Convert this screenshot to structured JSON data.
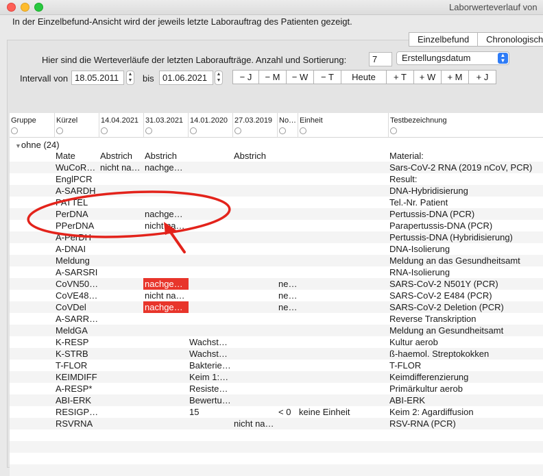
{
  "window": {
    "title": "Laborwerteverlauf von"
  },
  "info_text": "In der Einzelbefund-Ansicht wird der jeweils letzte Laborauftrag des Patienten gezeigt.",
  "view_tabs": [
    "Einzelbefund",
    "Chronologisch"
  ],
  "controls": {
    "intro_label": "Hier sind die Werteverläufe der letzten Laboraufträge. Anzahl und Sortierung:",
    "count_value": "7",
    "sort_value": "Erstellungsdatum",
    "interval_label": "Intervall von",
    "date_from": "18.05.2011",
    "bis_label": "bis",
    "date_to": "01.06.2021",
    "range_buttons": [
      "− J",
      "− M",
      "− W",
      "− T",
      "Heute",
      "+ T",
      "+ W",
      "+ M",
      "+ J"
    ]
  },
  "table": {
    "columns": [
      "Gruppe",
      "Kürzel",
      "14.04.2021",
      "31.03.2021",
      "14.01.2020",
      "27.03.2019",
      "No…",
      "Einheit",
      "Testbezeichnung"
    ],
    "group_label": "ohne (24)",
    "rows": [
      [
        "",
        "Mate",
        "Abstrich",
        "Abstrich",
        "",
        "Abstrich",
        "",
        "",
        "Material:"
      ],
      [
        "",
        "WuCoR…",
        "nicht na…",
        "nachge…",
        "",
        "",
        "",
        "",
        "Sars-CoV-2 RNA (2019 nCoV, PCR)"
      ],
      [
        "",
        "EnglPCR",
        "",
        "",
        "",
        "",
        "",
        "",
        "Result:"
      ],
      [
        "",
        "A-SARDH",
        "",
        "",
        "",
        "",
        "",
        "",
        "DNA-Hybridisierung"
      ],
      [
        "",
        "PATTEL",
        "",
        "",
        "",
        "",
        "",
        "",
        "Tel.-Nr. Patient"
      ],
      [
        "",
        "PerDNA",
        "",
        "nachge…",
        "",
        "",
        "",
        "",
        "Pertussis-DNA (PCR)"
      ],
      [
        "",
        "PPerDNA",
        "",
        "nicht na…",
        "",
        "",
        "",
        "",
        "Parapertussis-DNA (PCR)"
      ],
      [
        "",
        "A-PerDH",
        "",
        "",
        "",
        "",
        "",
        "",
        "Pertussis-DNA (Hybridisierung)"
      ],
      [
        "",
        "A-DNAI",
        "",
        "",
        "",
        "",
        "",
        "",
        "DNA-Isolierung"
      ],
      [
        "",
        "Meldung",
        "",
        "",
        "",
        "",
        "",
        "",
        "Meldung an das Gesundheitsamt"
      ],
      [
        "",
        "A-SARSRI",
        "",
        "",
        "",
        "",
        "",
        "",
        "RNA-Isolierung"
      ],
      [
        "",
        "CoVN50…",
        "",
        "nachge…",
        "",
        "",
        "ne…",
        "",
        "SARS-CoV-2 N501Y (PCR)"
      ],
      [
        "",
        "CoVE48…",
        "",
        "nicht na…",
        "",
        "",
        "ne…",
        "",
        "SARS-CoV-2 E484 (PCR)"
      ],
      [
        "",
        "CoVDel",
        "",
        "nachge…",
        "",
        "",
        "ne…",
        "",
        "SARS-CoV-2 Deletion (PCR)"
      ],
      [
        "",
        "A-SARR…",
        "",
        "",
        "",
        "",
        "",
        "",
        "Reverse Transkription"
      ],
      [
        "",
        "MeldGA",
        "",
        "",
        "",
        "",
        "",
        "",
        "Meldung an Gesundheitsamt"
      ],
      [
        "",
        "K-RESP",
        "",
        "",
        "Wachst…",
        "",
        "",
        "",
        "Kultur aerob"
      ],
      [
        "",
        "K-STRB",
        "",
        "",
        "Wachst…",
        "",
        "",
        "",
        "ß-haemol. Streptokokken"
      ],
      [
        "",
        "T-FLOR",
        "",
        "",
        "Bakterie…",
        "",
        "",
        "",
        "T-FLOR"
      ],
      [
        "",
        "KEIMDIFF",
        "",
        "",
        "Keim 1:…",
        "",
        "",
        "",
        "Keimdifferenzierung"
      ],
      [
        "",
        "A-RESP*",
        "",
        "",
        "Resiste…",
        "",
        "",
        "",
        "Primärkultur aerob"
      ],
      [
        "",
        "ABI-ERK",
        "",
        "",
        "Bewertu…",
        "",
        "",
        "",
        "ABI-ERK"
      ],
      [
        "",
        "RESIGP…",
        "",
        "",
        "15",
        "",
        "< 0",
        "keine Einheit",
        "Keim 2: Agardiffusion"
      ],
      [
        "",
        "RSVRNA",
        "",
        "",
        "",
        "nicht na…",
        "",
        "",
        "RSV-RNA (PCR)"
      ]
    ],
    "flagged_cells": [
      [
        11,
        3
      ],
      [
        13,
        3
      ]
    ],
    "flag_color": "#e8352b"
  },
  "annotation": {
    "color": "#e3231b"
  }
}
